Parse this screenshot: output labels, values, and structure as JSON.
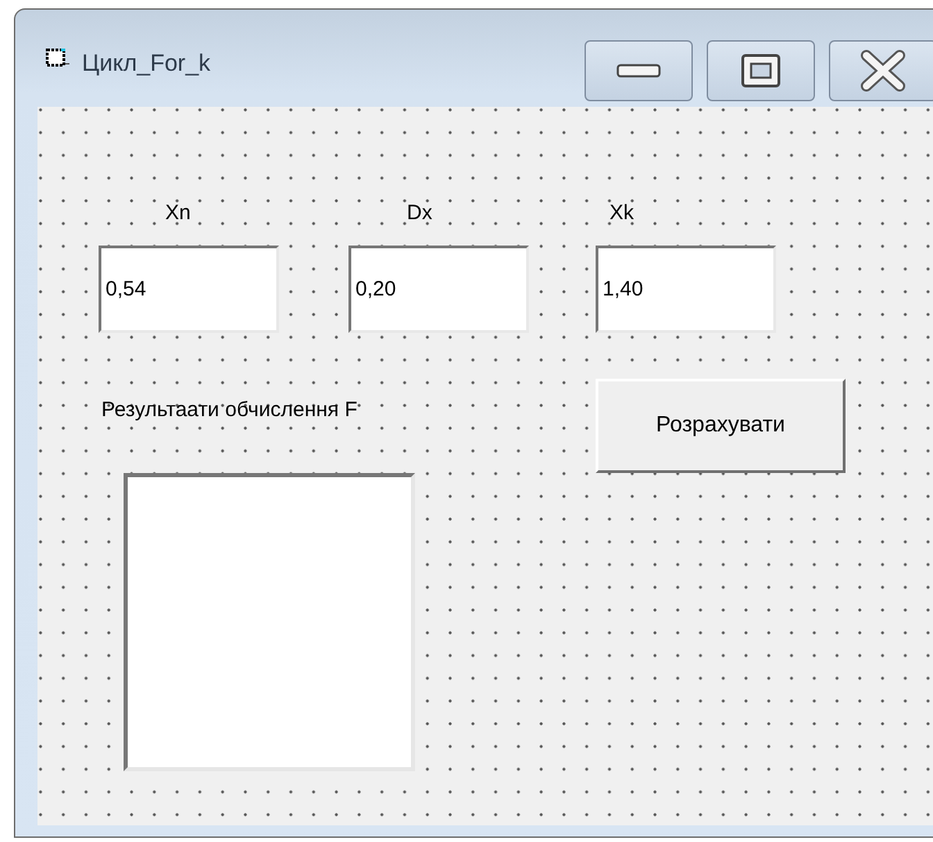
{
  "window": {
    "title": "Цикл_For_k"
  },
  "controls": [
    {
      "kind": "label",
      "text": "Xn"
    },
    {
      "kind": "label",
      "text": "Dx"
    },
    {
      "kind": "label",
      "text": "Xk"
    },
    {
      "kind": "edit",
      "value": "0,54"
    },
    {
      "kind": "edit",
      "value": "0,20"
    },
    {
      "kind": "edit",
      "value": "1,40"
    },
    {
      "kind": "label",
      "text": "Результаати обчислення  F"
    },
    {
      "kind": "button",
      "text": "Розрахувати"
    },
    {
      "kind": "memo"
    }
  ]
}
